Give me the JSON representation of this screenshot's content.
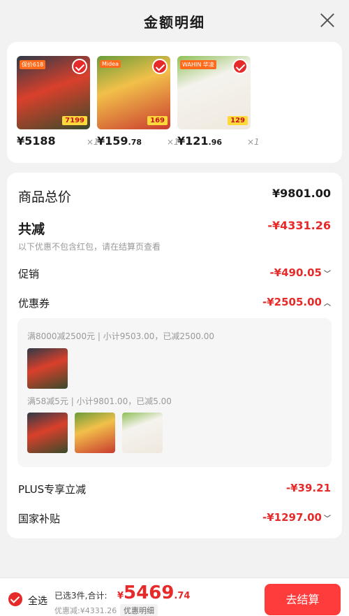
{
  "header": {
    "title": "金额明细"
  },
  "products": [
    {
      "price_int": "¥5188",
      "price_dec": "",
      "qty": "×1",
      "tag": "保价618",
      "badge": "7199"
    },
    {
      "price_int": "¥159",
      "price_dec": ".78",
      "qty": "×1",
      "tag": "Midea",
      "badge": "169"
    },
    {
      "price_int": "¥121",
      "price_dec": ".96",
      "qty": "×1",
      "tag": "WAHIN 华凌",
      "badge": "129"
    }
  ],
  "summary": {
    "total_label": "商品总价",
    "total_value": "¥9801.00",
    "discount_label": "共减",
    "discount_value": "-¥4331.26",
    "discount_note": "以下优惠不包含红包，请在结算页查看",
    "promo_label": "促销",
    "promo_value": "-¥490.05",
    "coupon_label": "优惠券",
    "coupon_value": "-¥2505.00",
    "coupons": [
      {
        "text": "满8000减2500元 | 小计9503.00，已减2500.00"
      },
      {
        "text": "满58减5元 | 小计9801.00，已减5.00"
      }
    ],
    "plus_label": "PLUS专享立减",
    "plus_value": "-¥39.21",
    "subsidy_label": "国家补贴",
    "subsidy_value": "-¥1297.00"
  },
  "bottom": {
    "select_all": "全选",
    "selected_text": "已选3件,合计:",
    "total_yen": "¥",
    "total_int": "5469",
    "total_dec": ".74",
    "discount_text": "优惠减:¥4331.26",
    "detail_label": "优惠明细",
    "checkout_label": "去结算"
  },
  "colors": {
    "accent": "#e62a2a",
    "checkout": "#ff3c3c"
  }
}
